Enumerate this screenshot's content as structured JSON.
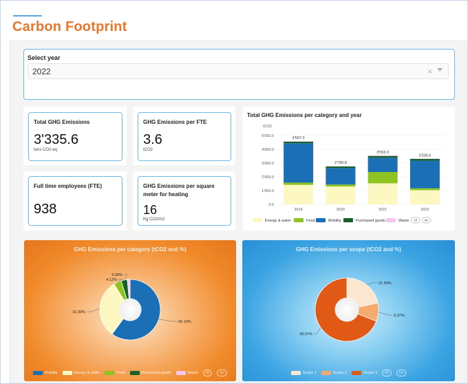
{
  "page": {
    "title": "Carbon Footprint"
  },
  "year_filter": {
    "label": "Select year",
    "value": "2022",
    "clear_symbol": "×"
  },
  "kpis": {
    "total": {
      "title": "Total GHG Emissions",
      "value": "3'335.6",
      "unit": "tons CO2-eq"
    },
    "per_fte": {
      "title": "GHG Emissions per FTE",
      "value": "3.6",
      "unit": "tCO2"
    },
    "fte": {
      "title": "Full time employees (FTE)",
      "value": "938",
      "unit": ""
    },
    "per_sqm": {
      "title": "GHG Emissions per square meter for heating",
      "value": "16",
      "unit": "Kg CO2/m2"
    }
  },
  "colors": {
    "mobility": "#1b6fb4",
    "energy_water": "#fdf7c2",
    "food": "#8ec41f",
    "purchased_goods": "#17622a",
    "waste": "#f4c6ec",
    "scope1": "#fbe6cf",
    "scope2": "#f5ab70",
    "scope3": "#e05a16"
  },
  "legend_buttons": {
    "all": "All",
    "inv": "Inv"
  },
  "chart_data": [
    {
      "type": "bar",
      "title": "Total GHG Emissions per category and year",
      "ylabel": "tCO2",
      "categories": [
        "2019",
        "2020",
        "2021",
        "2022"
      ],
      "totals": [
        "4'597.3",
        "2'790.8",
        "3'553.3",
        "3'335.6"
      ],
      "ylim": [
        0,
        5000
      ],
      "yticks": [
        "0.0",
        "1'000.0",
        "2'000.0",
        "3'000.0",
        "4'000.0",
        "5'000.0"
      ],
      "stacked": true,
      "legend": "bottom",
      "series": [
        {
          "name": "Energy & water",
          "values": [
            1420,
            1300,
            1530,
            1030
          ]
        },
        {
          "name": "Food",
          "values": [
            160,
            140,
            820,
            140
          ]
        },
        {
          "name": "Mobility",
          "values": [
            2860,
            1200,
            1040,
            2000
          ]
        },
        {
          "name": "Purchased goods",
          "values": [
            120,
            120,
            130,
            130
          ]
        },
        {
          "name": "Waste",
          "values": [
            37,
            31,
            33,
            36
          ]
        }
      ]
    },
    {
      "type": "pie",
      "title": "GHG Emissions per category (tCO2 and %)",
      "legend": "bottom",
      "slices": [
        {
          "name": "Mobility",
          "value": 60.12,
          "label": "60.12%"
        },
        {
          "name": "Energy & water",
          "value": 31.0,
          "label": "31.00%"
        },
        {
          "name": "Food",
          "value": 4.12,
          "label": "4.12%"
        },
        {
          "name": "Purchased goods",
          "value": 3.3,
          "label": "3.30%"
        },
        {
          "name": "Waste",
          "value": 1.46,
          "label": ""
        }
      ]
    },
    {
      "type": "pie",
      "title": "GHG Emissions per scope (tCO2 and %)",
      "legend": "bottom",
      "slices": [
        {
          "name": "Scope 1",
          "value": 21.56,
          "label": "21.56%"
        },
        {
          "name": "Scope 2",
          "value": 9.37,
          "label": "9.37%"
        },
        {
          "name": "Scope 3",
          "value": 69.07,
          "label": "69.07%"
        }
      ]
    }
  ]
}
